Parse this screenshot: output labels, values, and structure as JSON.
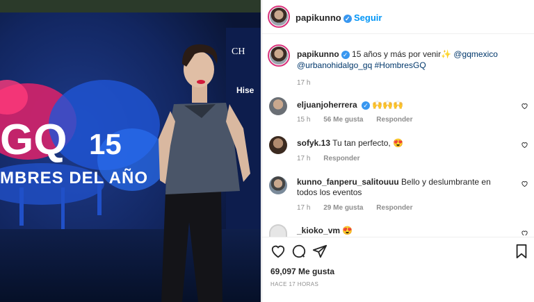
{
  "post": {
    "username": "papikunno",
    "follow_label": "Seguir",
    "caption_user": "papikunno",
    "caption_text": "15 años y más por venir",
    "caption_tag1": "@gqmexico",
    "caption_tag2": "@urbanohidalgo_gq",
    "caption_hashtag": "#HombresGQ",
    "caption_time": "17 h",
    "likes": "69,097 Me gusta",
    "time_ago": "HACE 17 HORAS"
  },
  "comments": [
    {
      "user": "eljuanjoherrera",
      "text": "🙌🙌🙌",
      "time": "15 h",
      "likes": "56 Me gusta",
      "reply": "Responder"
    },
    {
      "user": "sofyk.13",
      "text": "Tu tan perfecto, 😍",
      "time": "17 h",
      "likes": "",
      "reply": "Responder"
    },
    {
      "user": "kunno_fanperu_salitouuu",
      "text": "Bello y deslumbrante en todos los eventos",
      "time": "17 h",
      "likes": "29 Me gusta",
      "reply": "Responder"
    },
    {
      "user": "_kioko_vm",
      "text": "😍",
      "time": "",
      "likes": "",
      "reply": ""
    }
  ],
  "photo": {
    "logo_gq": "GQ",
    "logo_15": "15",
    "banner_text": "MBRES DEL AÑO",
    "sponsor1": "CH",
    "sponsor2": "Hise"
  },
  "colors": {
    "link": "#00376b",
    "follow": "#0095f6",
    "muted": "#8e8e8e"
  },
  "icons": [
    "verified-icon",
    "heart-icon",
    "comment-icon",
    "share-icon",
    "bookmark-icon",
    "sparkles-icon"
  ]
}
